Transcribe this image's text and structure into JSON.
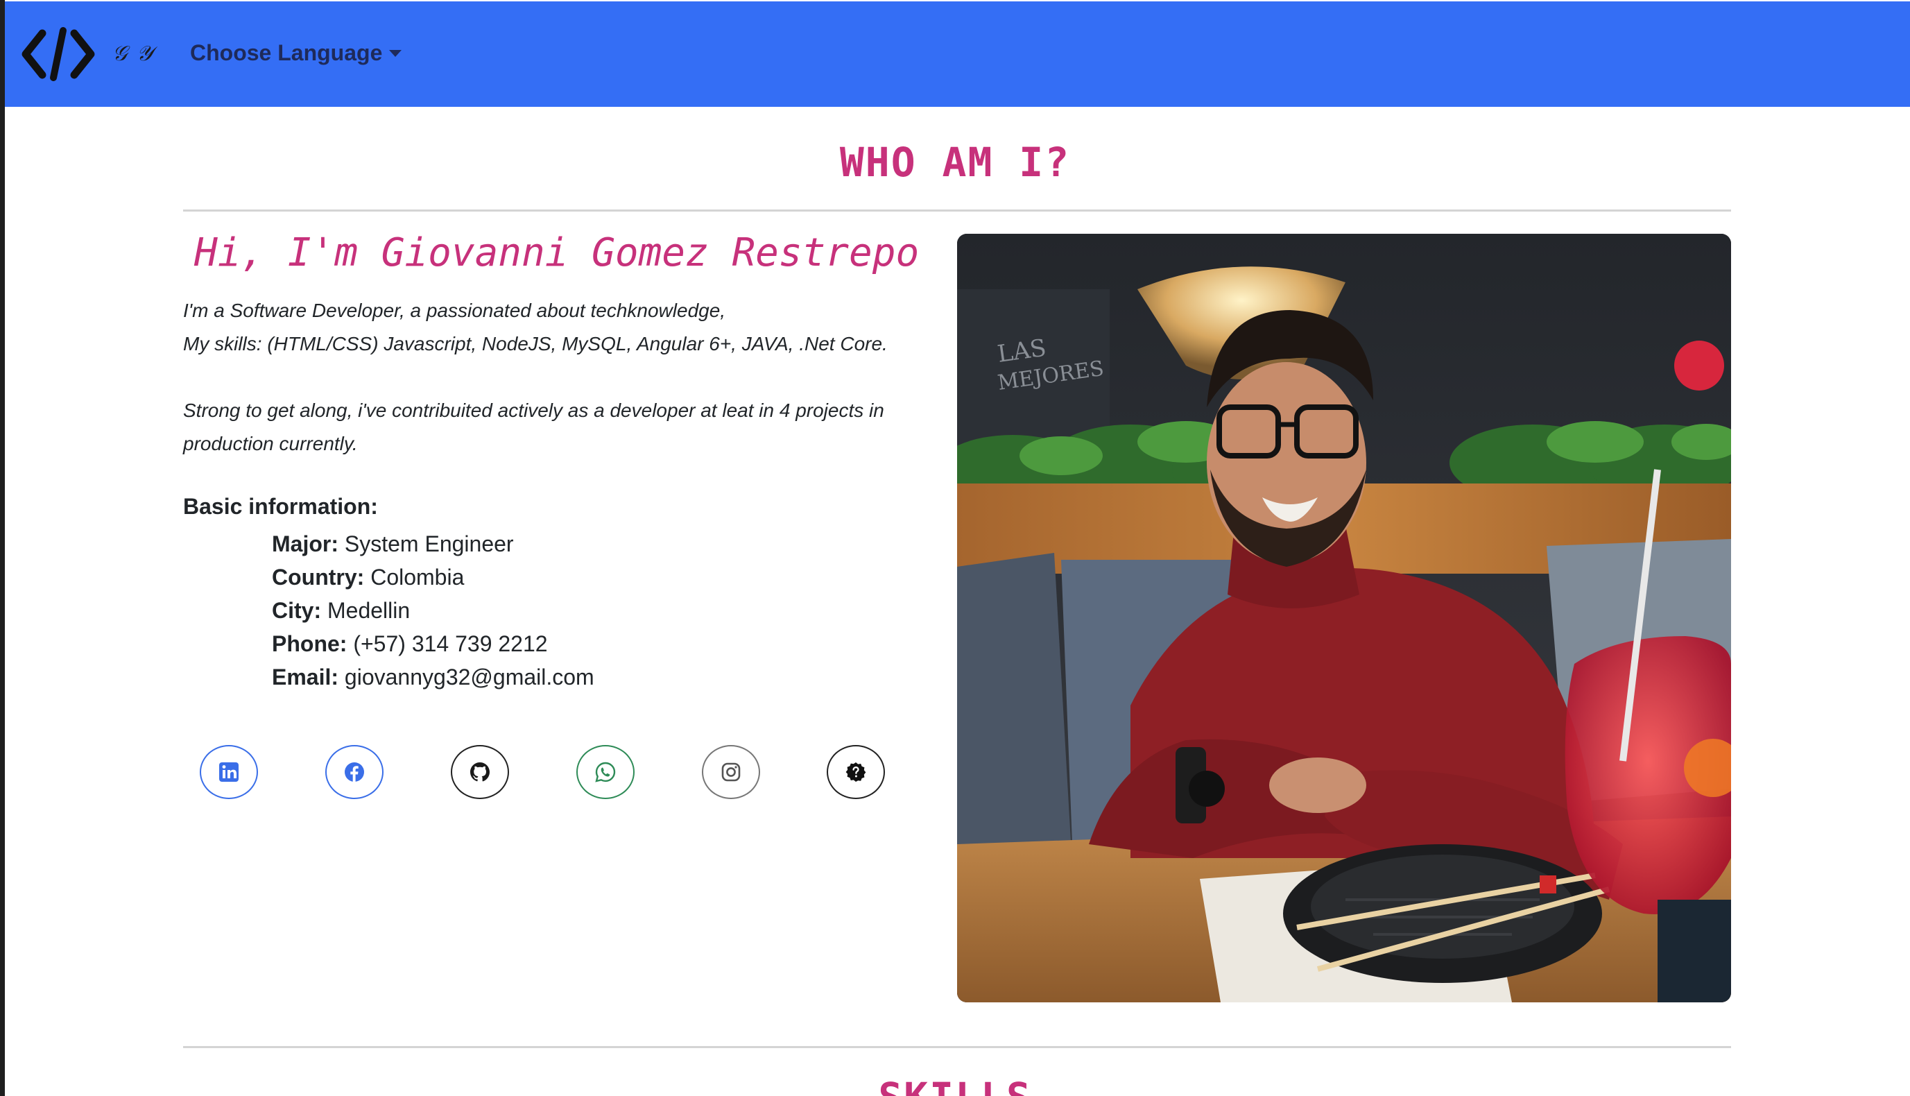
{
  "navbar": {
    "logo_icon": "code-brackets-icon",
    "initials": "𝒢 𝒴",
    "language_label": "Choose Language"
  },
  "about": {
    "title": "WHO AM I?",
    "greeting": "Hi, I'm Giovanni Gomez Restrepo",
    "intro_line1": "I'm a Software Developer, a passionated about techknowledge,",
    "intro_line2": "My skills: (HTML/CSS) Javascript, NodeJS, MySQL, Angular 6+, JAVA, .Net Core.",
    "intro_line3": "Strong to get along, i've contribuited actively as a developer at leat in 4 projects in production currently.",
    "basic_title": "Basic information:",
    "info": [
      {
        "label": "Major:",
        "value": "System Engineer"
      },
      {
        "label": "Country:",
        "value": "Colombia"
      },
      {
        "label": "City:",
        "value": "Medellin"
      },
      {
        "label": "Phone:",
        "value": "(+57) 314 739 2212"
      },
      {
        "label": "Email:",
        "value": "giovannyg32@gmail.com"
      }
    ],
    "socials": [
      {
        "icon": "linkedin-icon",
        "color": "#3a6ee8"
      },
      {
        "icon": "facebook-icon",
        "color": "#3a6ee8"
      },
      {
        "icon": "github-icon",
        "color": "#222222"
      },
      {
        "icon": "whatsapp-icon",
        "color": "#2e8b57"
      },
      {
        "icon": "instagram-icon",
        "color": "#777777"
      },
      {
        "icon": "question-badge-icon",
        "color": "#222222"
      }
    ]
  },
  "skills": {
    "title": "SKILLS"
  },
  "colors": {
    "navbar": "#346ef5",
    "accent": "#c7317b"
  }
}
